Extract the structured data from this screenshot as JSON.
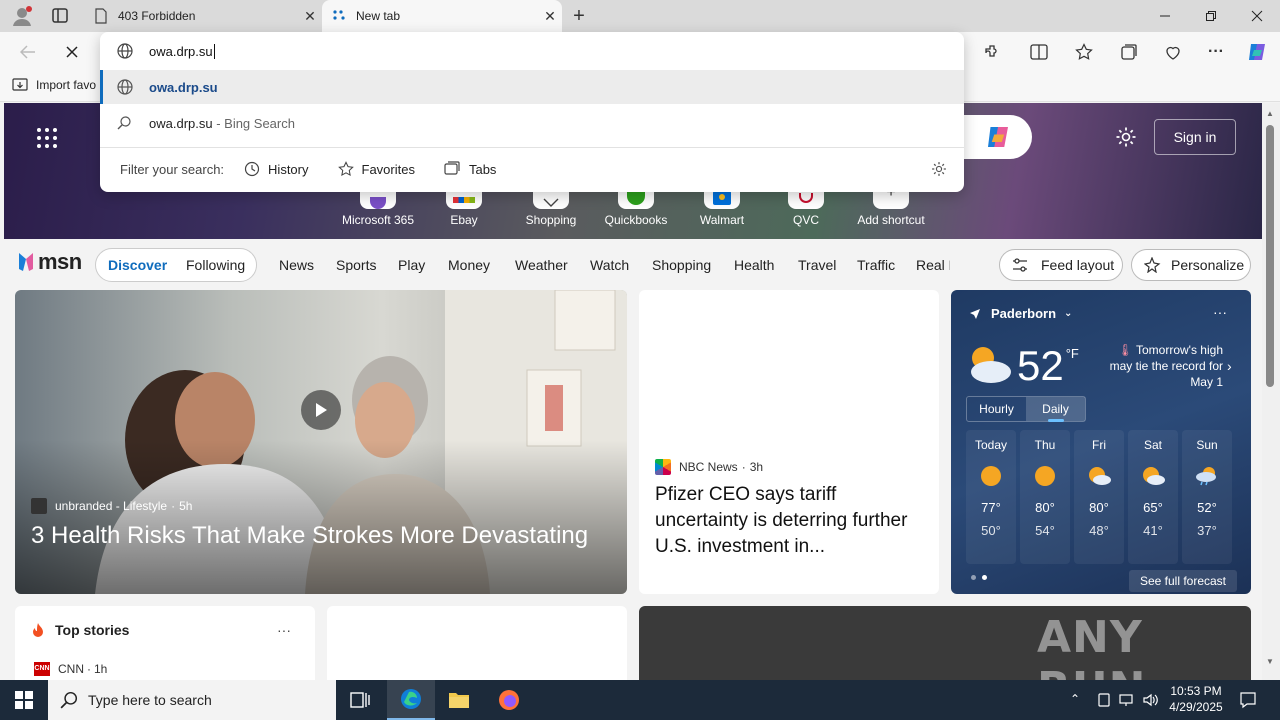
{
  "tabs": [
    {
      "title": "403 Forbidden"
    },
    {
      "title": "New tab"
    }
  ],
  "address": {
    "value": "owa.drp.su"
  },
  "suggestions": [
    {
      "text": "owa.drp.su",
      "suffix": ""
    },
    {
      "text": "owa.drp.su",
      "suffix": " - Bing Search"
    }
  ],
  "filter": {
    "label": "Filter your search:",
    "history": "History",
    "favorites": "Favorites",
    "tabs": "Tabs"
  },
  "favbar": {
    "import_label": "Import favo"
  },
  "hero": {
    "sign_in": "Sign in",
    "shortcuts": [
      "Microsoft 365",
      "Ebay",
      "Shopping",
      "Quickbooks",
      "Walmart",
      "QVC",
      "Add shortcut"
    ]
  },
  "msn": {
    "logo": "msn",
    "discover": "Discover",
    "following": "Following",
    "nav": [
      "News",
      "Sports",
      "Play",
      "Money",
      "Weather",
      "Watch",
      "Shopping",
      "Health",
      "Travel",
      "Traffic",
      "Real E"
    ],
    "feed_layout": "Feed layout",
    "personalize": "Personalize"
  },
  "main_story": {
    "source": "unbranded - Lifestyle",
    "age": "5h",
    "headline": "3 Health Risks That Make Strokes More Devastating"
  },
  "side_story": {
    "source": "NBC News",
    "age": "3h",
    "headline": "Pfizer CEO says tariff uncertainty is deterring further U.S. investment in..."
  },
  "weather": {
    "location": "Paderborn",
    "temp": "52",
    "unit": "°F",
    "alert": "Tomorrow's high may tie the record for May 1",
    "tab_hourly": "Hourly",
    "tab_daily": "Daily",
    "days": [
      {
        "day": "Today",
        "high": "77°",
        "low": "50°",
        "icon": "sunny-icon"
      },
      {
        "day": "Thu",
        "high": "80°",
        "low": "54°",
        "icon": "sunny-icon"
      },
      {
        "day": "Fri",
        "high": "80°",
        "low": "48°",
        "icon": "partly-cloudy-icon"
      },
      {
        "day": "Sat",
        "high": "65°",
        "low": "41°",
        "icon": "partly-cloudy-icon"
      },
      {
        "day": "Sun",
        "high": "52°",
        "low": "37°",
        "icon": "rain-icon"
      }
    ],
    "see_full": "See full forecast"
  },
  "top_stories": {
    "title": "Top stories",
    "first_source": "CNN",
    "first_age": "1h"
  },
  "watermark": "ANY RUN",
  "taskbar": {
    "search_placeholder": "Type here to search",
    "time": "10:53 PM",
    "date": "4/29/2025"
  },
  "colors": {
    "accent": "#0f6cbd",
    "msn_discover": "#0f6cbd",
    "weather_bg": "#1f3a63",
    "taskbar": "#1c2a3a"
  }
}
